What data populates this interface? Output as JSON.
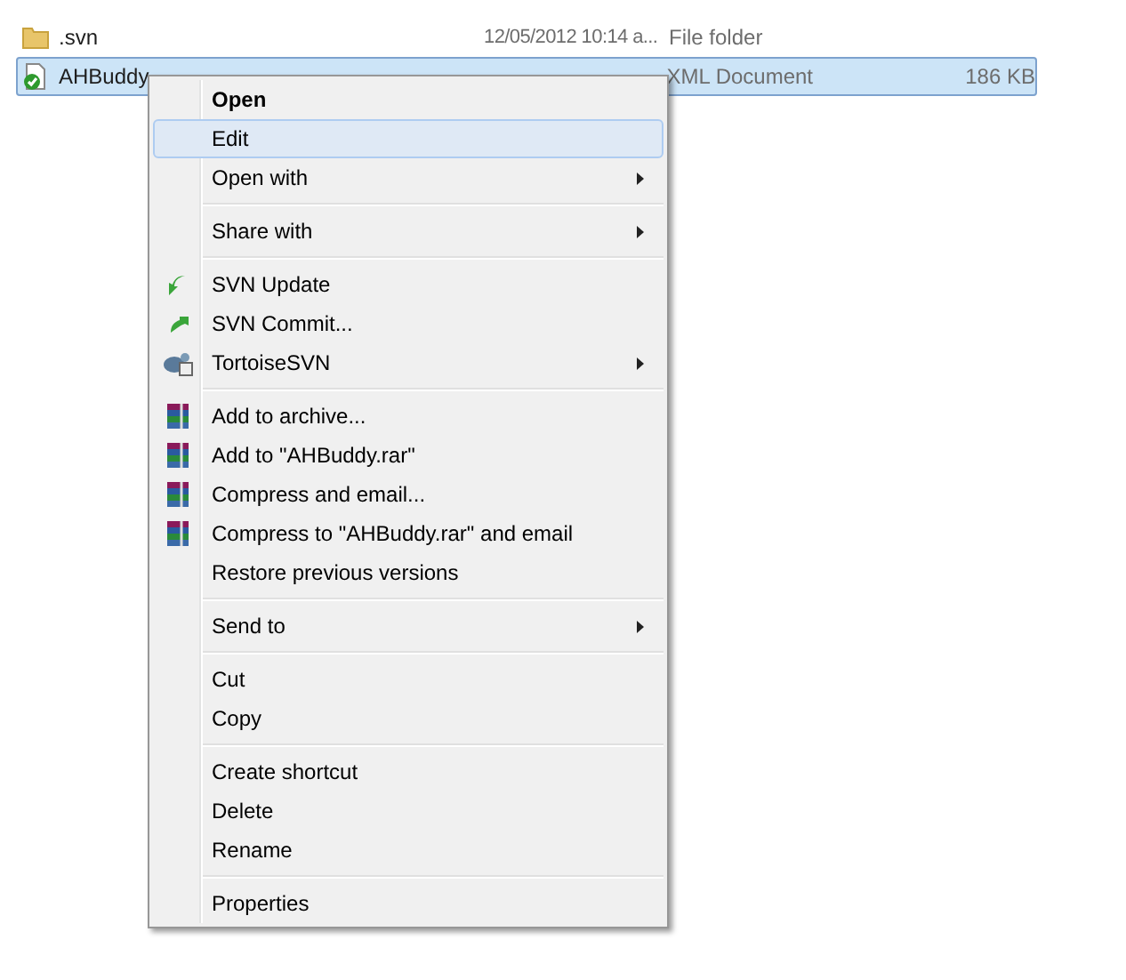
{
  "file_list": [
    {
      "name": ".svn",
      "date": "12/05/2012 10:14 a...",
      "type": "File folder",
      "kind": "folder",
      "selected": false
    },
    {
      "name": "AHBuddy",
      "type": "XML Document",
      "size": "186 KB",
      "kind": "document",
      "selected": true
    }
  ],
  "context_menu": {
    "groups": [
      [
        {
          "label": "Open",
          "kind": "plain",
          "default": true,
          "selected": false
        },
        {
          "label": "Edit",
          "kind": "plain",
          "selected": true
        },
        {
          "label": "Open with",
          "kind": "plain",
          "submenu": true,
          "selected": false
        }
      ],
      [
        {
          "label": "Share with",
          "kind": "plain",
          "submenu": true,
          "selected": false
        }
      ],
      [
        {
          "label": "SVN Update",
          "kind": "update",
          "selected": false
        },
        {
          "label": "SVN Commit...",
          "kind": "commit",
          "selected": false
        },
        {
          "label": "TortoiseSVN",
          "kind": "tortoise",
          "submenu": true,
          "selected": false
        }
      ],
      [
        {
          "label": "Add to archive...",
          "kind": "archive",
          "selected": false
        },
        {
          "label": "Add to \"AHBuddy.rar\"",
          "kind": "archive",
          "selected": false
        },
        {
          "label": "Compress and email...",
          "kind": "archive",
          "selected": false
        },
        {
          "label": "Compress to \"AHBuddy.rar\" and email",
          "kind": "archive",
          "selected": false
        },
        {
          "label": "Restore previous versions",
          "kind": "plain",
          "selected": false
        }
      ],
      [
        {
          "label": "Send to",
          "kind": "plain",
          "submenu": true,
          "selected": false
        }
      ],
      [
        {
          "label": "Cut",
          "kind": "plain",
          "selected": false
        },
        {
          "label": "Copy",
          "kind": "plain",
          "selected": false
        }
      ],
      [
        {
          "label": "Create shortcut",
          "kind": "plain",
          "selected": false
        },
        {
          "label": "Delete",
          "kind": "plain",
          "selected": false
        },
        {
          "label": "Rename",
          "kind": "plain",
          "selected": false
        }
      ],
      [
        {
          "label": "Properties",
          "kind": "plain",
          "selected": false
        }
      ]
    ]
  }
}
